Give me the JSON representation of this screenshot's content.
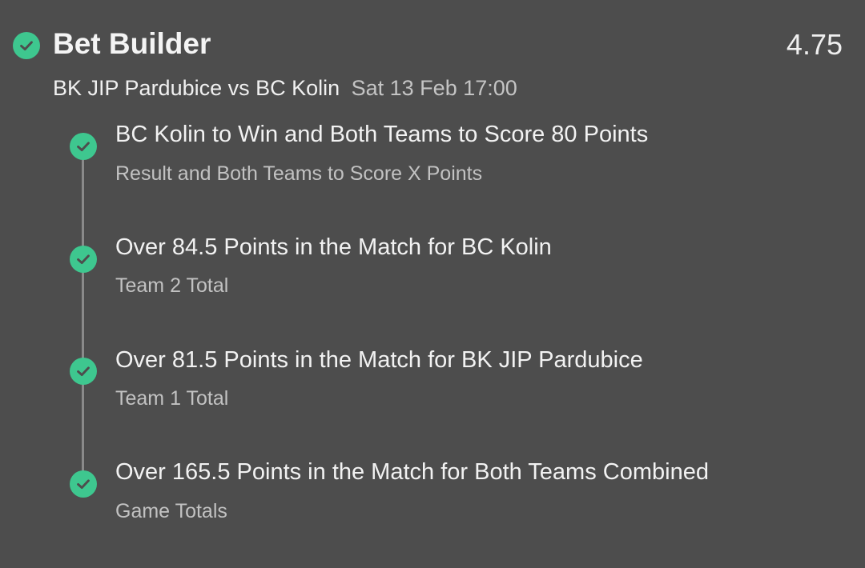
{
  "header": {
    "title": "Bet Builder",
    "odds": "4.75"
  },
  "event": {
    "match": "BK JIP Pardubice vs BC Kolin",
    "datetime": "Sat 13 Feb 17:00"
  },
  "legs": [
    {
      "selection": "BC Kolin to Win and Both Teams to Score 80 Points",
      "market": "Result and Both Teams to Score X Points"
    },
    {
      "selection": "Over 84.5 Points in the Match for BC Kolin",
      "market": "Team 2 Total"
    },
    {
      "selection": "Over 81.5 Points in the Match for BK JIP Pardubice",
      "market": "Team 1 Total"
    },
    {
      "selection": "Over 165.5 Points in the Match for Both Teams Combined",
      "market": "Game Totals"
    }
  ],
  "colors": {
    "background": "#4d4d4d",
    "check": "#3ec78f",
    "timeline": "#8a8a8a"
  },
  "icons": {
    "check": "check-circle-icon"
  }
}
